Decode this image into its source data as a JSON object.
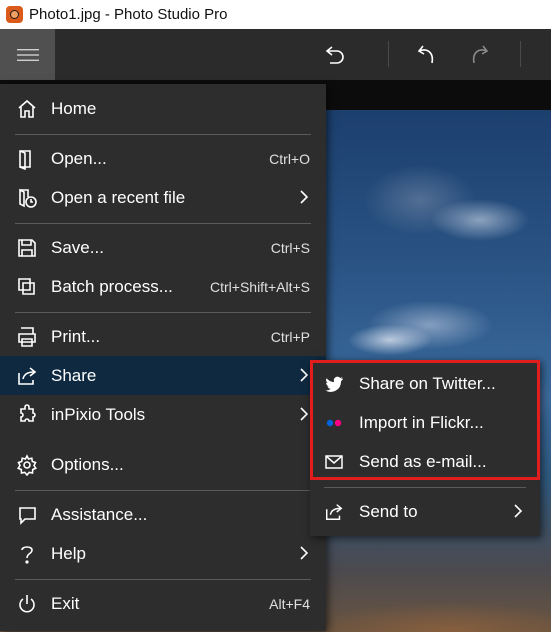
{
  "window": {
    "title": "Photo1.jpg - Photo Studio Pro"
  },
  "toolbar": {
    "icons": [
      "menu-icon",
      "reset-icon",
      "undo-icon",
      "redo-icon"
    ]
  },
  "menu": {
    "items": [
      {
        "label": "Home",
        "shortcut": ""
      },
      {
        "label": "Open...",
        "shortcut": "Ctrl+O"
      },
      {
        "label": "Open a recent file",
        "shortcut": ""
      },
      {
        "label": "Save...",
        "shortcut": "Ctrl+S"
      },
      {
        "label": "Batch process...",
        "shortcut": "Ctrl+Shift+Alt+S"
      },
      {
        "label": "Print...",
        "shortcut": "Ctrl+P"
      },
      {
        "label": "Share",
        "shortcut": ""
      },
      {
        "label": "inPixio Tools",
        "shortcut": ""
      },
      {
        "label": "Options...",
        "shortcut": ""
      },
      {
        "label": "Assistance...",
        "shortcut": ""
      },
      {
        "label": "Help",
        "shortcut": ""
      },
      {
        "label": "Exit",
        "shortcut": "Alt+F4"
      }
    ]
  },
  "share_submenu": {
    "items": [
      {
        "label": "Share on Twitter..."
      },
      {
        "label": "Import in Flickr..."
      },
      {
        "label": "Send as e-mail..."
      },
      {
        "label": "Send to"
      }
    ]
  },
  "colors": {
    "accent_highlight": "#e31d1d",
    "active_row": "#0f2a40",
    "flickr_blue": "#0063dc",
    "flickr_pink": "#ff0084"
  }
}
